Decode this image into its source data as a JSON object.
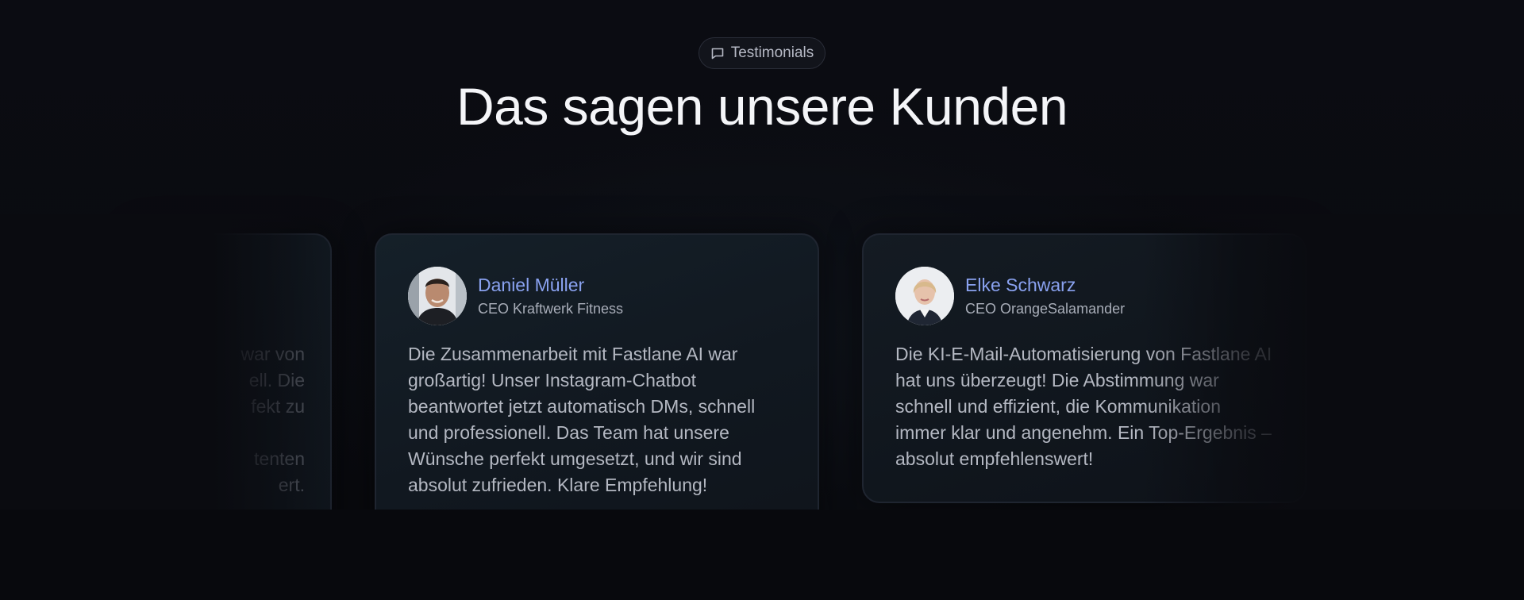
{
  "header": {
    "badge_label": "Testimonials",
    "badge_icon": "chat-bubble-icon",
    "title": "Das sagen unsere Kunden"
  },
  "testimonials": [
    {
      "lines": [
        "war von",
        "ell. Die",
        "fekt zu",
        "",
        "tenten",
        "ert."
      ]
    },
    {
      "name": "Daniel Müller",
      "role": "CEO Kraftwerk Fitness",
      "quote": "Die Zusammenarbeit mit Fastlane AI war großartig! Unser Instagram-Chatbot beantwortet jetzt automatisch DMs, schnell und professionell. Das Team hat unsere Wünsche perfekt umgesetzt, und wir sind absolut zufrieden. Klare Empfehlung!"
    },
    {
      "name": "Elke Schwarz",
      "role": "CEO OrangeSalamander",
      "quote": "Die KI-E-Mail-Automatisierung von Fastlane AI hat uns überzeugt! Die Abstimmung war schnell und effizient, die Kommunikation immer klar und angenehm. Ein Top-Ergebnis – absolut empfehlenswert!"
    }
  ],
  "colors": {
    "background": "#0a0b10",
    "name_accent": "#8aa2f0",
    "title": "#f4f5f8"
  }
}
